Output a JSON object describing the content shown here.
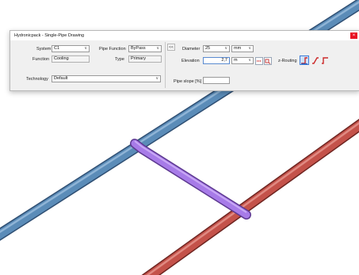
{
  "dialog": {
    "title": "Hydronicpack - Single-Pipe Drawing",
    "close_glyph": "×",
    "system": {
      "label": "System",
      "value": "C1"
    },
    "function": {
      "label": "Function",
      "value": "Cooling"
    },
    "technology": {
      "label": "Technology",
      "value": "Default"
    },
    "pipe_function": {
      "label": "Pipe Function",
      "value": "ByPass"
    },
    "type": {
      "label": "Type",
      "value": "Primary"
    },
    "collapse_glyph": "<<",
    "diameter": {
      "label": "Diameter",
      "value": "25",
      "unit": "mm"
    },
    "elevation": {
      "label": "Elevation",
      "value": "2,7",
      "unit": "m"
    },
    "pipe_slope": {
      "label": "Pipe slope [%]",
      "value": ""
    },
    "z_routing": {
      "label": "z-Routing"
    }
  },
  "scene": {
    "pipe_colors": {
      "supply_blue": "#5b8cb8",
      "return_red": "#c4524a",
      "bypass_purple": "#a77be8"
    }
  }
}
